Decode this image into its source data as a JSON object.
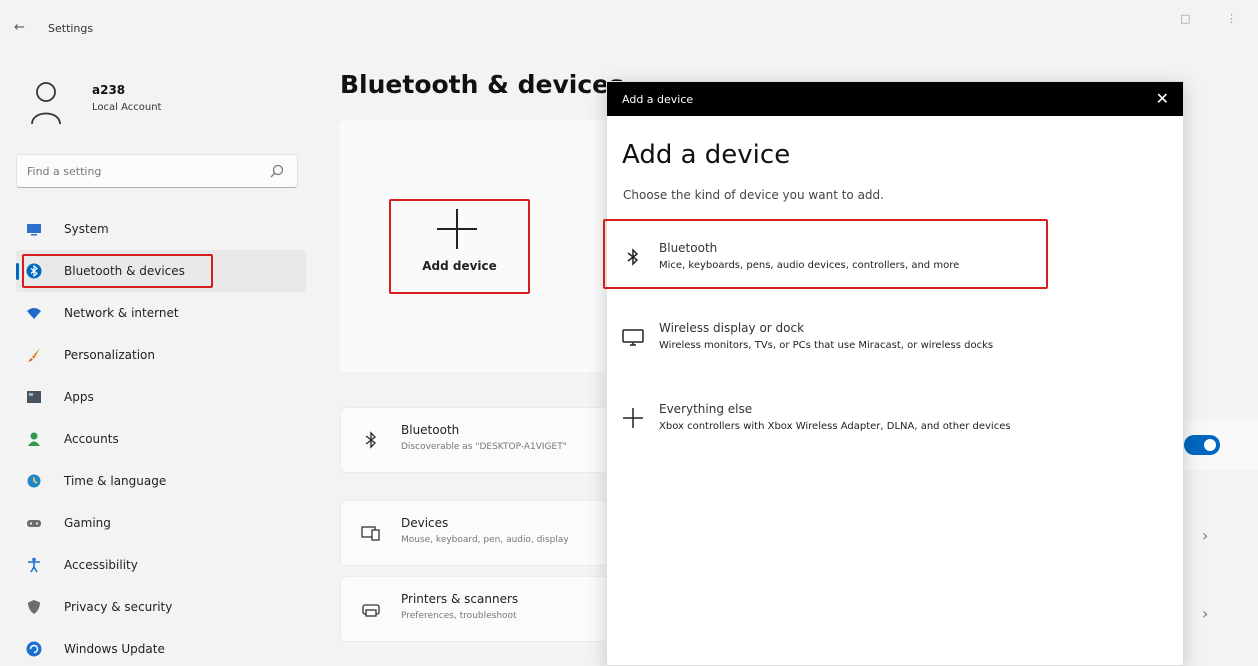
{
  "window": {
    "title": "Settings"
  },
  "user": {
    "name": "a238",
    "account_type": "Local Account"
  },
  "search": {
    "placeholder": "Find a setting"
  },
  "sidebar": {
    "items": [
      {
        "label": "System",
        "icon": "monitor-icon",
        "color": "#2f6fd0"
      },
      {
        "label": "Bluetooth & devices",
        "icon": "bluetooth-icon",
        "color": "#0067c0",
        "active": true
      },
      {
        "label": "Network & internet",
        "icon": "wifi-icon",
        "color": "#1f67c8"
      },
      {
        "label": "Personalization",
        "icon": "brush-icon",
        "color": "#e0862a"
      },
      {
        "label": "Apps",
        "icon": "apps-icon",
        "color": "#4a5360"
      },
      {
        "label": "Accounts",
        "icon": "person-icon",
        "color": "#2e9a4b"
      },
      {
        "label": "Time & language",
        "icon": "globe-clock-icon",
        "color": "#1f86c8"
      },
      {
        "label": "Gaming",
        "icon": "controller-icon",
        "color": "#6d6d6d"
      },
      {
        "label": "Accessibility",
        "icon": "accessibility-icon",
        "color": "#1f6fd0"
      },
      {
        "label": "Privacy & security",
        "icon": "shield-icon",
        "color": "#6d6d6d"
      },
      {
        "label": "Windows Update",
        "icon": "update-icon",
        "color": "#1f6fd0"
      }
    ]
  },
  "main": {
    "title": "Bluetooth & devices",
    "add_device_label": "Add device",
    "rows": [
      {
        "title": "Bluetooth",
        "subtitle": "Discoverable as \"DESKTOP-A1VIGET\"",
        "icon": "bluetooth-icon"
      },
      {
        "title": "Devices",
        "subtitle": "Mouse, keyboard, pen, audio, display",
        "icon": "devices-icon"
      },
      {
        "title": "Printers & scanners",
        "subtitle": "Preferences, troubleshoot",
        "icon": "printer-icon"
      }
    ]
  },
  "dialog": {
    "bar_title": "Add a device",
    "heading": "Add a device",
    "subtitle": "Choose the kind of device you want to add.",
    "options": [
      {
        "title": "Bluetooth",
        "subtitle": "Mice, keyboards, pens, audio devices, controllers, and more",
        "icon": "bluetooth-icon",
        "highlighted": true
      },
      {
        "title": "Wireless display or dock",
        "subtitle": "Wireless monitors, TVs, or PCs that use Miracast, or wireless docks",
        "icon": "display-icon"
      },
      {
        "title": "Everything else",
        "subtitle": "Xbox controllers with Xbox Wireless Adapter, DLNA, and other devices",
        "icon": "plus-icon"
      }
    ]
  },
  "colors": {
    "accent": "#0067c0",
    "highlight_box": "#d91d1d"
  }
}
